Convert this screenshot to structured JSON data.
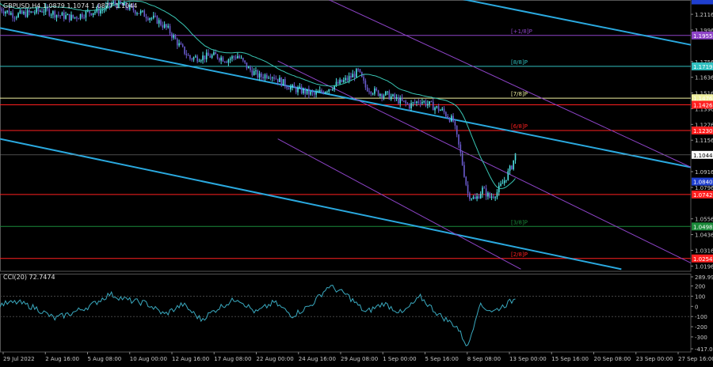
{
  "window": {
    "main_header": "GBPUSD,H4  1.0879 1.1074 1.0877 1.1044",
    "sub_header": "CCI(20) 72.7474",
    "background": "#000000"
  },
  "colors": {
    "bull_candle": "#4fe3e6",
    "bear_candle": "#6a5acd",
    "moving_average": "#39c6b4",
    "trend_line": "#2aa9df",
    "channel_line": "#8e44c8",
    "red_level": "#ff2020",
    "cyan_level": "#30c0c0",
    "axis_text": "#c8c8c8",
    "cci_line": "#3aaac0"
  },
  "chart_data": [
    {
      "type": "line",
      "series_kind": "candlestick",
      "price_axis": {
        "ticks": [
          "1.2116",
          "1.1996",
          "1.1756",
          "1.1636",
          "1.1516",
          "1.1396",
          "1.1276",
          "1.1156",
          "1.0916",
          "1.0796",
          "1.0556",
          "1.0436",
          "1.0316",
          "1.0196"
        ],
        "ylim": [
          1.0156,
          1.2225
        ]
      },
      "time_axis": {
        "labels": [
          "29 Jul 2022",
          "2 Aug 16:00",
          "5 Aug 08:00",
          "10 Aug 00:00",
          "12 Aug 16:00",
          "17 Aug 08:00",
          "22 Aug 00:00",
          "24 Aug 16:00",
          "29 Aug 08:00",
          "1 Sep 00:00",
          "5 Sep 16:00",
          "8 Sep 08:00",
          "13 Sep 00:00",
          "15 Sep 16:00",
          "20 Sep 08:00",
          "23 Sep 00:00",
          "27 Sep 16:00"
        ],
        "count": 378
      },
      "current_price": {
        "value": 1.1044,
        "label": "1.1044"
      },
      "moving_average_label": "1.1044",
      "levels": [
        {
          "value": 1.1955,
          "label": "+1/8",
          "badge": "1.1955",
          "color": "#8e44c8",
          "tag": "[+1/8]P"
        },
        {
          "value": 1.1719,
          "label": "8/8",
          "badge": "1.1719",
          "color": "#30c0c0",
          "tag": "[8/8]P"
        },
        {
          "value": 1.1476,
          "label": "7/8",
          "badge": "1.1476",
          "color": "#f0f0a0",
          "tag": "[7/8]P"
        },
        {
          "value": 1.1426,
          "label": "",
          "badge": "1.1426",
          "color": "#ff2020",
          "tag": ""
        },
        {
          "value": 1.123,
          "label": "6/8",
          "badge": "1.1230",
          "color": "#ff2020",
          "tag": "[6/8]P"
        },
        {
          "value": 1.0742,
          "label": "4/8",
          "badge": "1.0742",
          "color": "#ff2020",
          "tag": ""
        },
        {
          "value": 1.0498,
          "label": "3/8",
          "badge": "1.0498",
          "color": "#1b8a3a",
          "tag": "[3/8]P"
        },
        {
          "value": 1.0254,
          "label": "2/8",
          "badge": "1.0254",
          "color": "#ff2020",
          "tag": "[2/8]P"
        }
      ],
      "extra_badges": [
        {
          "value": 1.084,
          "label": "1.0840",
          "color": "#1f3fcf"
        },
        {
          "value": 1.2222,
          "label": "",
          "color": "#1f3fcf"
        }
      ],
      "trend_lines": [
        {
          "from": [
            0,
            1.2012
          ],
          "to": [
            378,
            1.0949
          ],
          "color": "#2aa9df"
        },
        {
          "from": [
            0,
            1.1166
          ],
          "to": [
            340,
            1.0172
          ],
          "color": "#2aa9df"
        },
        {
          "from": [
            250,
            1.224
          ],
          "to": [
            378,
            1.1883
          ],
          "color": "#2aa9df"
        }
      ],
      "channel_lines": [
        {
          "from": [
            152,
            1.176
          ],
          "to": [
            378,
            1.022
          ],
          "color": "#8e44c8"
        },
        {
          "from": [
            152,
            1.1166
          ],
          "to": [
            285,
            1.0172
          ],
          "color": "#8e44c8"
        },
        {
          "from": [
            178,
            1.224
          ],
          "to": [
            378,
            1.095
          ],
          "color": "#8e44c8"
        }
      ],
      "price_path": [
        [
          0,
          1.216
        ],
        [
          8,
          1.211
        ],
        [
          16,
          1.2125
        ],
        [
          24,
          1.215
        ],
        [
          32,
          1.211
        ],
        [
          40,
          1.209
        ],
        [
          48,
          1.213
        ],
        [
          56,
          1.215
        ],
        [
          62,
          1.22
        ],
        [
          70,
          1.217
        ],
        [
          78,
          1.212
        ],
        [
          86,
          1.207
        ],
        [
          92,
          1.2
        ],
        [
          98,
          1.188
        ],
        [
          104,
          1.178
        ],
        [
          110,
          1.179
        ],
        [
          118,
          1.18
        ],
        [
          124,
          1.177
        ],
        [
          130,
          1.18
        ],
        [
          136,
          1.17
        ],
        [
          142,
          1.164
        ],
        [
          148,
          1.166
        ],
        [
          154,
          1.16
        ],
        [
          160,
          1.155
        ],
        [
          166,
          1.153
        ],
        [
          172,
          1.15
        ],
        [
          178,
          1.154
        ],
        [
          184,
          1.158
        ],
        [
          190,
          1.162
        ],
        [
          196,
          1.168
        ],
        [
          200,
          1.156
        ],
        [
          206,
          1.152
        ],
        [
          212,
          1.15
        ],
        [
          218,
          1.146
        ],
        [
          224,
          1.142
        ],
        [
          230,
          1.146
        ],
        [
          236,
          1.142
        ],
        [
          242,
          1.138
        ],
        [
          248,
          1.13
        ],
        [
          252,
          1.105
        ],
        [
          256,
          1.075
        ],
        [
          260,
          1.07
        ],
        [
          264,
          1.078
        ],
        [
          268,
          1.072
        ],
        [
          272,
          1.076
        ],
        [
          276,
          1.085
        ],
        [
          280,
          1.096
        ],
        [
          282,
          1.1044
        ]
      ]
    },
    {
      "type": "line",
      "title": "CCI(20) 72.7474",
      "ticks": [
        "289.9903",
        "200",
        "100",
        "0",
        "-100",
        "-200",
        "-300",
        "-417.0504"
      ],
      "ylim": [
        -417.0504,
        289.9903
      ],
      "x": [
        0,
        10,
        20,
        30,
        40,
        50,
        60,
        70,
        80,
        90,
        100,
        110,
        120,
        130,
        140,
        150,
        160,
        170,
        180,
        190,
        200,
        210,
        220,
        230,
        240,
        250,
        256,
        262,
        270,
        282
      ],
      "values": [
        20,
        40,
        -20,
        -120,
        -60,
        10,
        120,
        60,
        30,
        -80,
        20,
        -130,
        -10,
        80,
        -60,
        40,
        -90,
        10,
        200,
        110,
        -60,
        30,
        -70,
        90,
        -80,
        -200,
        -400,
        10,
        -50,
        72.7
      ]
    }
  ]
}
